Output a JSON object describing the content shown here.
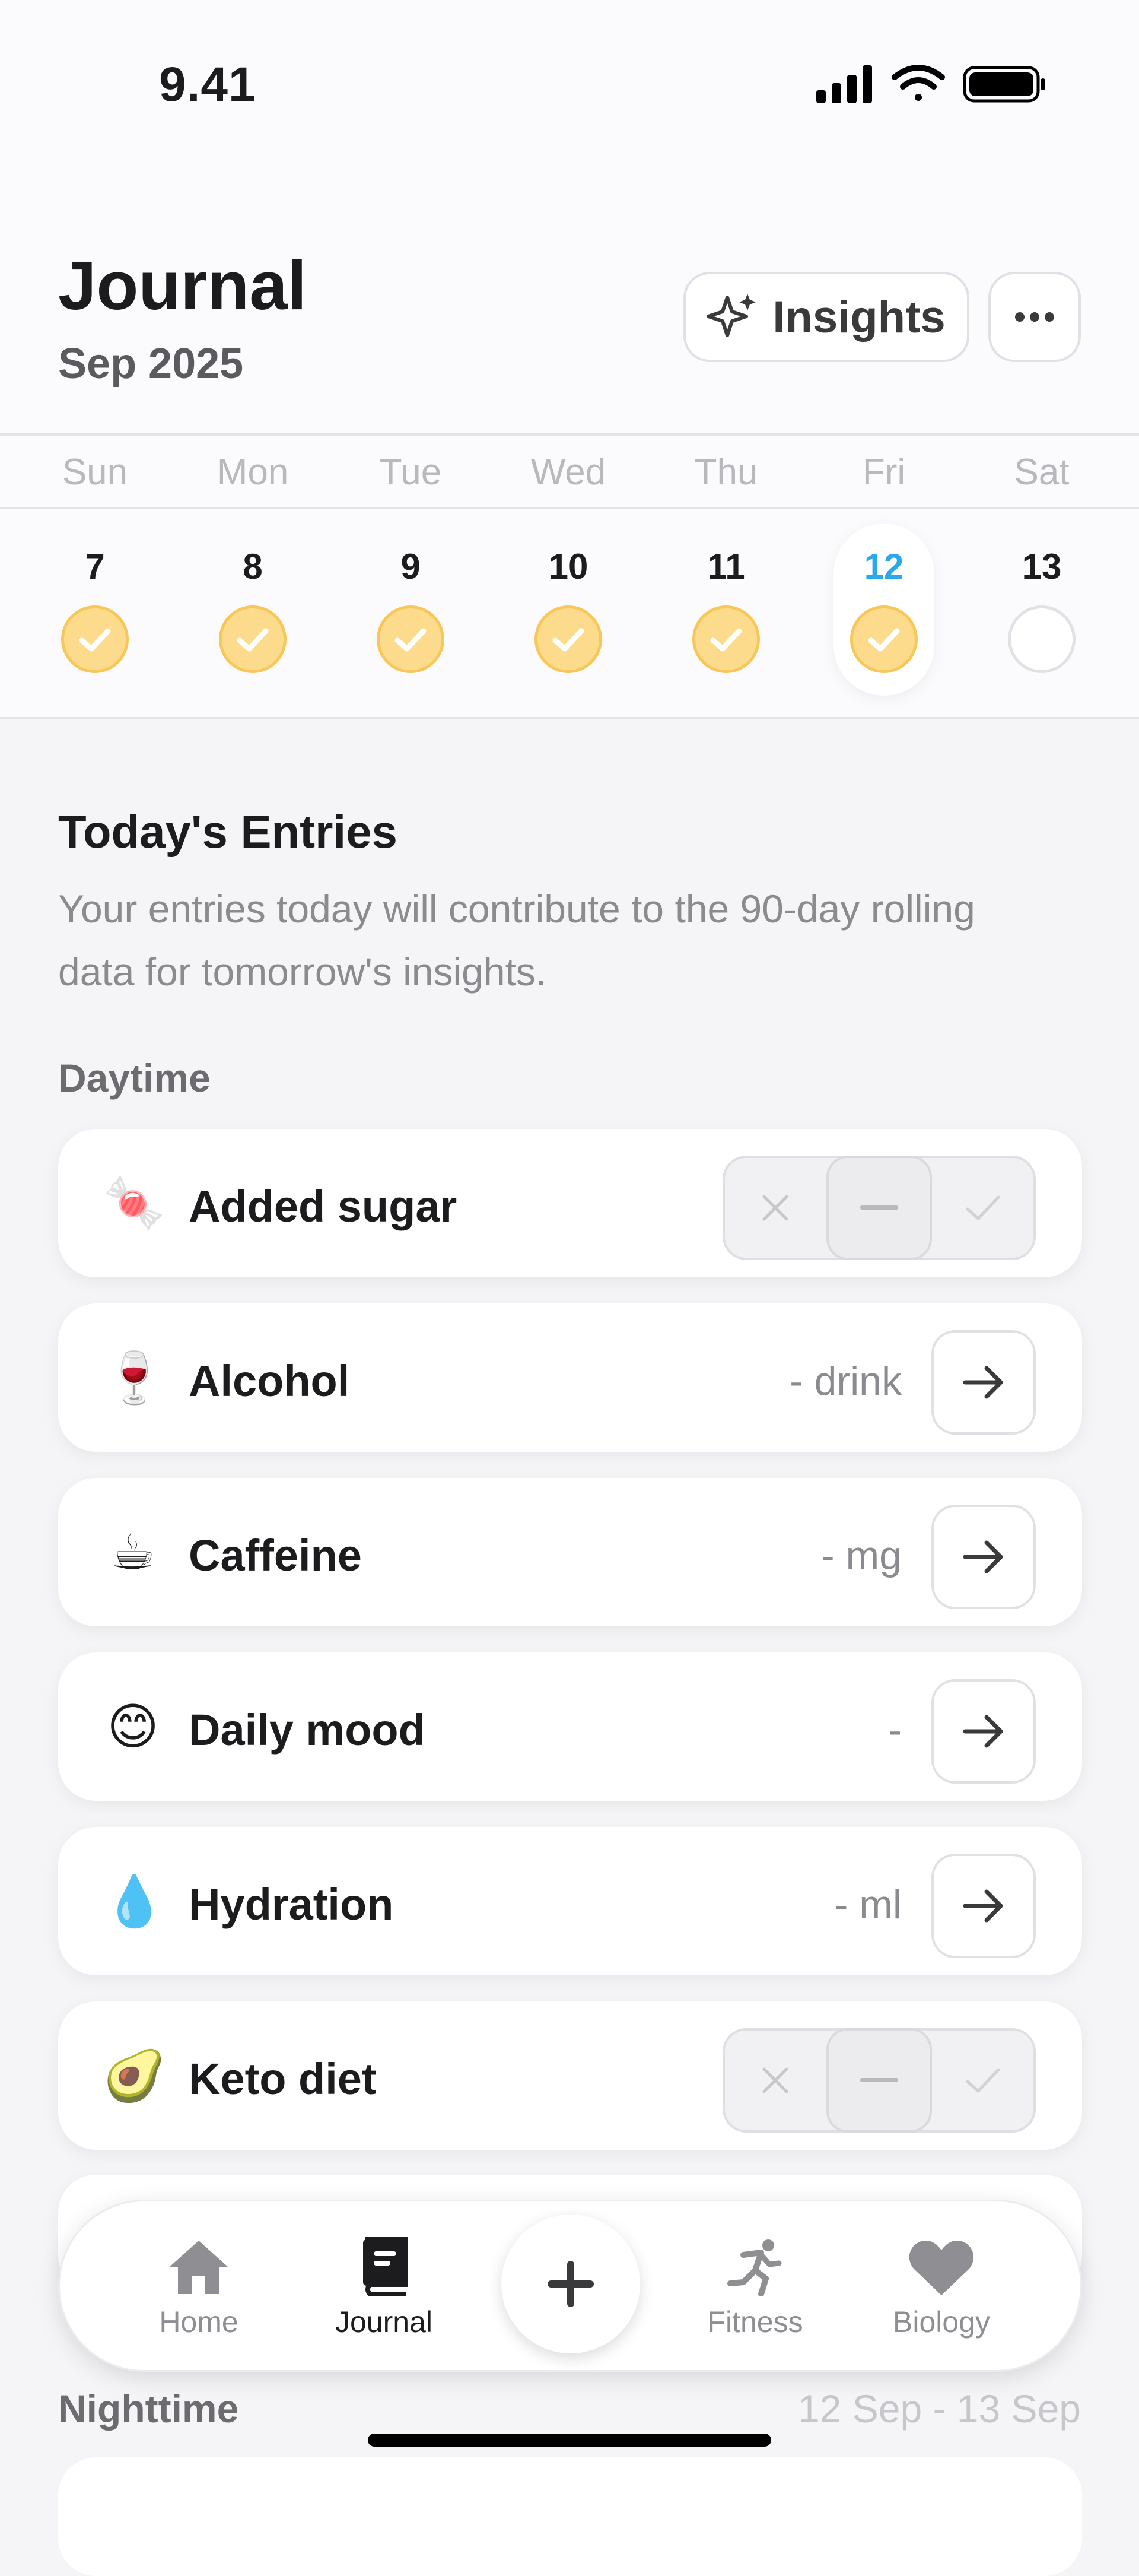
{
  "status_bar": {
    "time": "9.41"
  },
  "header": {
    "title": "Journal",
    "subtitle": "Sep 2025",
    "insights_label": "Insights"
  },
  "calendar": {
    "weekdays": [
      "Sun",
      "Mon",
      "Tue",
      "Wed",
      "Thu",
      "Fri",
      "Sat"
    ],
    "days": [
      {
        "num": "7",
        "state": "done"
      },
      {
        "num": "8",
        "state": "done"
      },
      {
        "num": "9",
        "state": "done"
      },
      {
        "num": "10",
        "state": "done"
      },
      {
        "num": "11",
        "state": "done"
      },
      {
        "num": "12",
        "state": "done",
        "selected": true
      },
      {
        "num": "13",
        "state": "empty"
      }
    ],
    "accent_color": "#2aa8ec",
    "done_color": "#fcdc8c"
  },
  "entries": {
    "title": "Today's Entries",
    "description": "Your entries today will contribute to the 90-day rolling data for tomorrow's insights.",
    "daytime_label": "Daytime",
    "items": [
      {
        "emoji": "🍬",
        "icon": "candy-icon",
        "name": "Added sugar",
        "control": "tri-state"
      },
      {
        "emoji": "🍷",
        "icon": "wine-glass-icon",
        "name": "Alcohol",
        "value": "- drink",
        "control": "arrow"
      },
      {
        "emoji": "☕",
        "icon": "coffee-cup-icon",
        "name": "Caffeine",
        "value": "- mg",
        "control": "arrow"
      },
      {
        "emoji": "😊",
        "icon": "smiling-face-icon",
        "name": "Daily mood",
        "value": "-",
        "control": "arrow"
      },
      {
        "emoji": "💧",
        "icon": "droplet-icon",
        "name": "Hydration",
        "value": "- ml",
        "control": "arrow"
      },
      {
        "emoji": "🥑",
        "icon": "avocado-icon",
        "name": "Keto diet",
        "control": "tri-state"
      }
    ],
    "nighttime_label": "Nighttime",
    "nighttime_range": "12 Sep - 13 Sep"
  },
  "nav": {
    "items": [
      {
        "label": "Home",
        "icon": "house-icon"
      },
      {
        "label": "Journal",
        "icon": "book-icon",
        "active": true
      },
      {
        "label": "Fitness",
        "icon": "runner-icon"
      },
      {
        "label": "Biology",
        "icon": "heart-icon"
      }
    ]
  }
}
